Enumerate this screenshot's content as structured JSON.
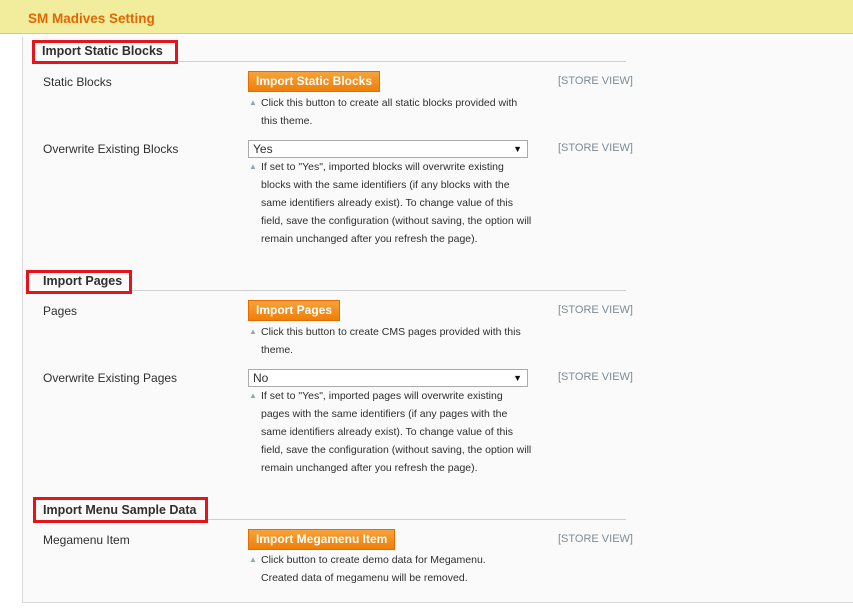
{
  "header": {
    "title": "SM Madives Setting"
  },
  "scope_label": "[STORE VIEW]",
  "sections": {
    "static_blocks": {
      "heading": "Import Static Blocks",
      "row1": {
        "label": "Static Blocks",
        "button": "Import Static Blocks",
        "note": "Click this button to create all static blocks provided with this theme."
      },
      "row2": {
        "label": "Overwrite Existing Blocks",
        "value": "Yes",
        "note": "If set to \"Yes\", imported blocks will overwrite existing blocks with the same identifiers (if any blocks with the same identifiers already exist). To change value of this field, save the configuration (without saving, the option will remain unchanged after you refresh the page)."
      }
    },
    "pages": {
      "heading": "Import Pages",
      "row1": {
        "label": "Pages",
        "button": "Import Pages",
        "note": "Click this button to create CMS pages provided with this theme."
      },
      "row2": {
        "label": "Overwrite Existing Pages",
        "value": "No",
        "note": "If set to \"Yes\", imported pages will overwrite existing pages with the same identifiers (if any pages with the same identifiers already exist). To change value of this field, save the configuration (without saving, the option will remain unchanged after you refresh the page)."
      }
    },
    "menu": {
      "heading": "Import Menu Sample Data",
      "row1": {
        "label": "Megamenu Item",
        "button": "Import Megamenu Item",
        "note": "Click button to create demo data for Megamenu. Created data of megamenu will be removed."
      }
    }
  },
  "colors": {
    "accent": "#ef7f07",
    "header_bg": "#f2ed9d",
    "title": "#e26703",
    "highlight_box": "#e3141b"
  }
}
